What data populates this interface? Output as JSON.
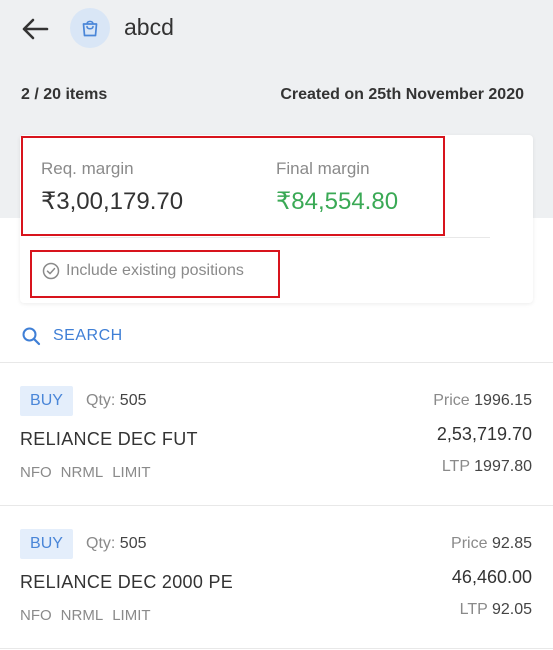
{
  "header": {
    "back_icon": "arrow-left-icon",
    "basket_icon": "basket-icon",
    "basket_name": "abcd"
  },
  "meta": {
    "items_count": "2 / 20 items",
    "created": "Created on 25th November 2020"
  },
  "margins": {
    "req_label": "Req. margin",
    "req_value": "₹3,00,179.70",
    "final_label": "Final margin",
    "final_value": "₹84,554.80",
    "include_label": "Include existing positions",
    "include_icon": "check-circle-icon"
  },
  "search": {
    "label": "SEARCH",
    "icon": "search-icon"
  },
  "orders": [
    {
      "side": "BUY",
      "qty_label": "Qty:",
      "qty": "505",
      "symbol": "RELIANCE DEC FUT",
      "exchange": "NFO",
      "product": "NRML",
      "order_type": "LIMIT",
      "price_label": "Price",
      "price": "1996.15",
      "amount": "2,53,719.70",
      "ltp_label": "LTP",
      "ltp": "1997.80"
    },
    {
      "side": "BUY",
      "qty_label": "Qty:",
      "qty": "505",
      "symbol": "RELIANCE DEC 2000 PE",
      "exchange": "NFO",
      "product": "NRML",
      "order_type": "LIMIT",
      "price_label": "Price",
      "price": "92.85",
      "amount": "46,460.00",
      "ltp_label": "LTP",
      "ltp": "92.05"
    }
  ],
  "colors": {
    "accent": "#3f7fd6",
    "positive": "#3aa955",
    "highlight": "#d8141d"
  }
}
